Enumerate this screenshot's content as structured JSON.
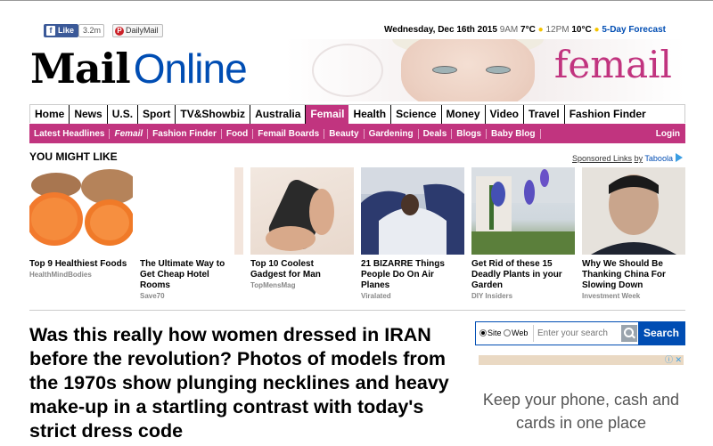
{
  "social": {
    "facebook_label": "Like",
    "facebook_count": "3.2m",
    "pinterest_label": "DailyMail"
  },
  "datebar": {
    "date": "Wednesday, Dec 16th 2015",
    "time1": "9AM",
    "temp1": "7°C",
    "time2": "12PM",
    "temp2": "10°C",
    "forecast_link": "5-Day Forecast"
  },
  "logo": {
    "part1": "Mail",
    "part2": "Online",
    "section_banner": "femail"
  },
  "nav": {
    "items": [
      "Home",
      "News",
      "U.S.",
      "Sport",
      "TV&Showbiz",
      "Australia",
      "Femail",
      "Health",
      "Science",
      "Money",
      "Video",
      "Travel",
      "Fashion Finder"
    ],
    "active": "Femail"
  },
  "subnav": {
    "items": [
      "Latest Headlines",
      "Femail",
      "Fashion Finder",
      "Food",
      "Femail Boards",
      "Beauty",
      "Gardening",
      "Deals",
      "Blogs",
      "Baby Blog"
    ],
    "login": "Login"
  },
  "recommend": {
    "heading": "YOU MIGHT LIKE",
    "sponsored_text": "Sponsored Links",
    "by_text": "by",
    "taboola": "Taboola",
    "cards": [
      {
        "title": "Top 9 Healthiest Foods",
        "source": "HealthMindBodies"
      },
      {
        "title": "The Ultimate Way to Get Cheap Hotel Rooms",
        "source": "Save70"
      },
      {
        "title": "Top 10 Coolest Gadgest for Man",
        "source": "TopMensMag"
      },
      {
        "title": "21 BIZARRE Things People Do On Air Planes",
        "source": "Viralated"
      },
      {
        "title": "Get Rid of these 15 Deadly Plants in your Garden",
        "source": "DIY Insiders"
      },
      {
        "title": "Why We Should Be Thanking China For Slowing Down",
        "source": "Investment Week"
      }
    ]
  },
  "article": {
    "headline": "Was this really how women dressed in IRAN before the revolution? Photos of models from the 1970s show plunging necklines and heavy make-up in a startling contrast with today's strict dress code"
  },
  "search": {
    "option_site": "Site",
    "option_web": "Web",
    "placeholder": "Enter your search",
    "button": "Search"
  },
  "ad": {
    "text": "Keep your phone, cash and cards in one place"
  },
  "colors": {
    "femail_pink": "#c1347f",
    "mail_blue": "#004db3"
  }
}
